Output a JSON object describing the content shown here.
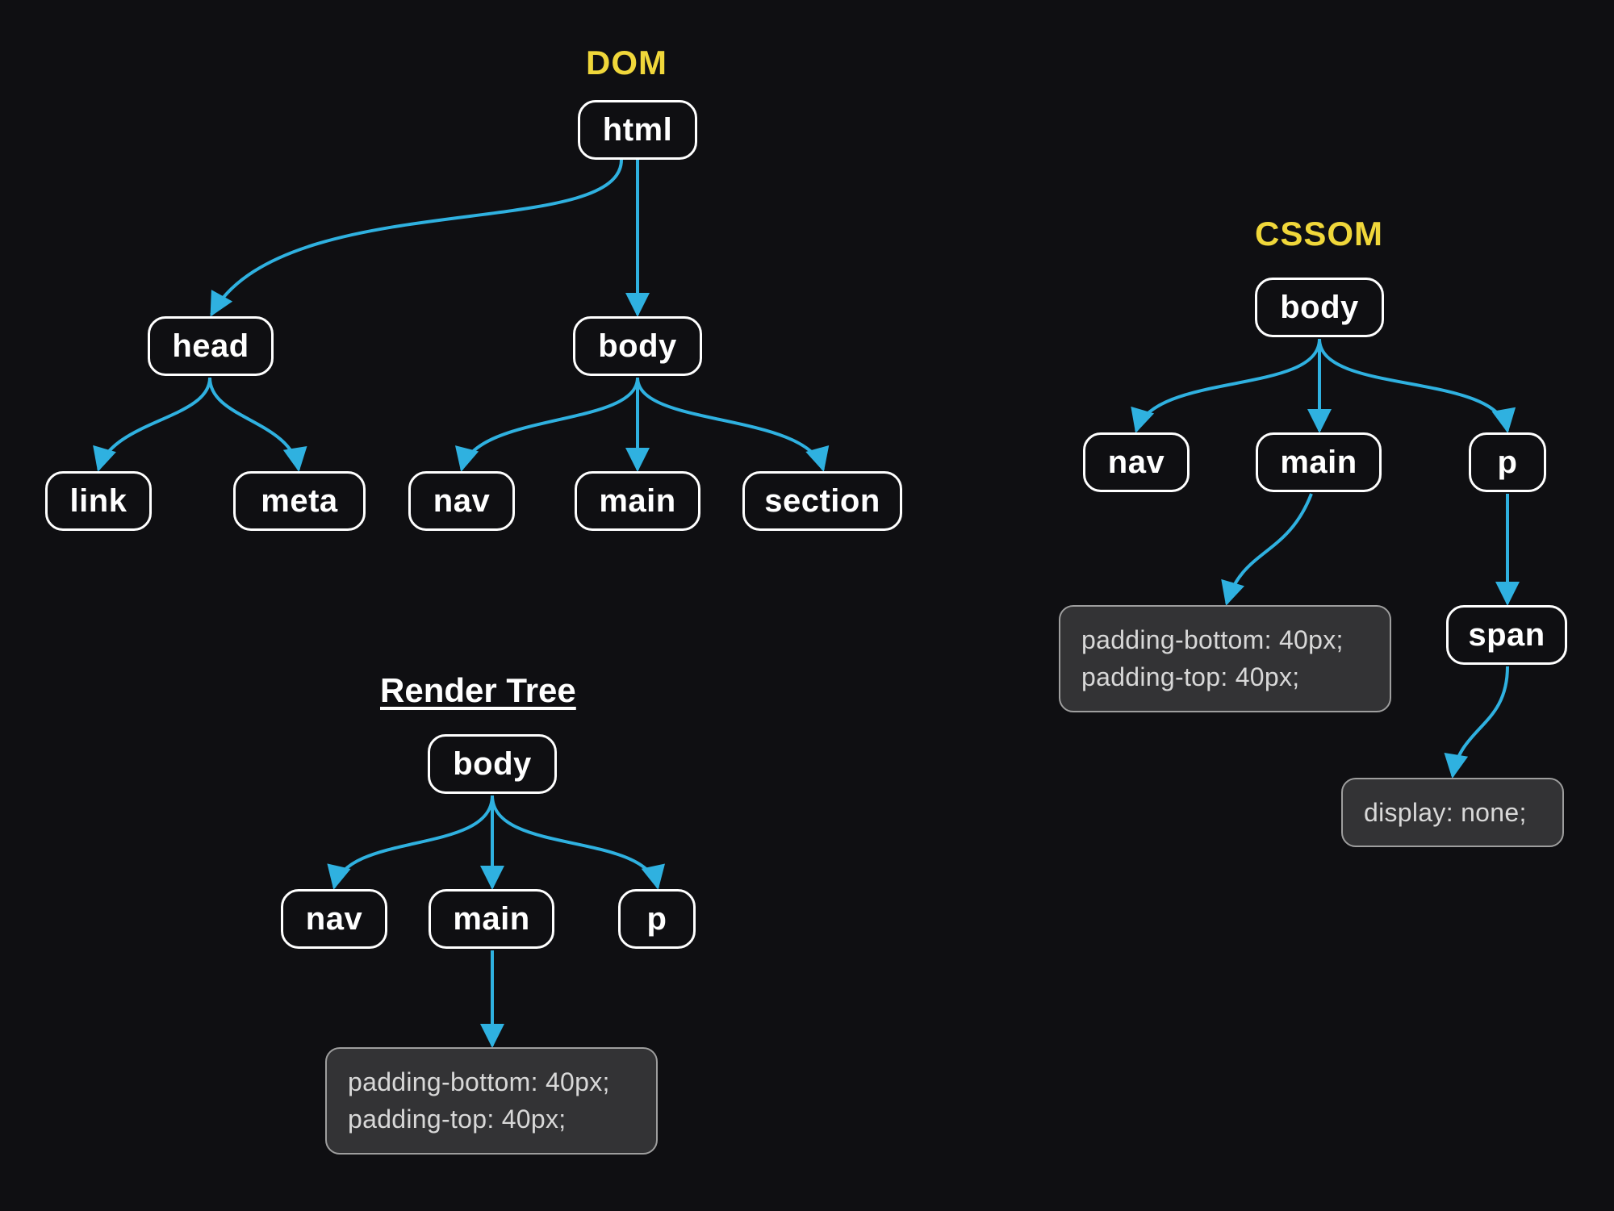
{
  "dom": {
    "title": "DOM",
    "html": "html",
    "head": "head",
    "body": "body",
    "link": "link",
    "meta": "meta",
    "nav": "nav",
    "main": "main",
    "section": "section"
  },
  "cssom": {
    "title": "CSSOM",
    "body": "body",
    "nav": "nav",
    "main": "main",
    "p": "p",
    "span": "span",
    "main_styles": "padding-bottom: 40px;\npadding-top: 40px;",
    "span_styles": "display: none;"
  },
  "render": {
    "title": "Render Tree",
    "body": "body",
    "nav": "nav",
    "main": "main",
    "p": "p",
    "main_styles": "padding-bottom: 40px;\npadding-top: 40px;"
  },
  "colors": {
    "accent_title": "#f0d73a",
    "edge": "#2fb1e0",
    "node_border": "#ffffff",
    "stylebox_bg": "#333335",
    "stylebox_border": "#9e9e9e",
    "bg": "#0f0f12"
  }
}
